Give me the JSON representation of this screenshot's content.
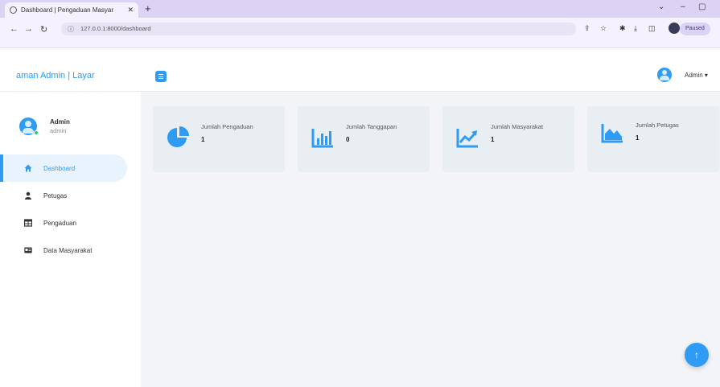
{
  "browser": {
    "tab_title": "Dashboard | Pengaduan Masyar",
    "tab_close": "✕",
    "new_tab": "+",
    "url": "127.0.0.1:8000/dashboard",
    "profile_label": "Paused",
    "minimize": "⌄",
    "restore": "–",
    "maximize": "▢",
    "more": "⋮"
  },
  "sidebar": {
    "brand": "aman Admin | Layar",
    "user": {
      "name": "Admin",
      "role": "admin"
    },
    "items": [
      {
        "label": "Dashboard",
        "icon": "home-icon",
        "active": true
      },
      {
        "label": "Petugas",
        "icon": "user-icon",
        "active": false
      },
      {
        "label": "Pengaduan",
        "icon": "table-icon",
        "active": false
      },
      {
        "label": "Data Masyarakat",
        "icon": "id-card-icon",
        "active": false
      }
    ]
  },
  "topbar": {
    "admin_label": "Admin ▾"
  },
  "cards": [
    {
      "label": "Jumlah Pengaduan",
      "value": "1",
      "icon": "pie-chart-icon"
    },
    {
      "label": "Jumlah Tanggapan",
      "value": "0",
      "icon": "bar-chart-icon"
    },
    {
      "label": "Jumlah Masyarakat",
      "value": "1",
      "icon": "line-chart-icon"
    },
    {
      "label": "Jumlah Petugas",
      "value": "1",
      "icon": "area-chart-icon"
    }
  ],
  "fab_label": "↑",
  "colors": {
    "accent": "#2e9cf4",
    "card_bg": "#e9eef3",
    "tabbar": "#dcd2f3"
  }
}
